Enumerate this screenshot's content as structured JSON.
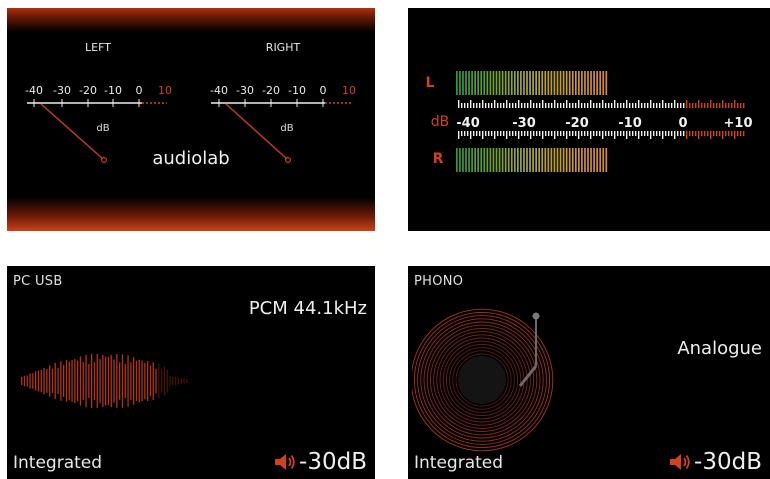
{
  "analog_meter": {
    "left_label": "LEFT",
    "right_label": "RIGHT",
    "scale": [
      "-40",
      "-30",
      "-20",
      "-10",
      "0",
      "10"
    ],
    "unit": "dB",
    "logo": "audiolab"
  },
  "bar_meter": {
    "left_label": "L",
    "right_label": "R",
    "unit": "dB",
    "scale": [
      "-40",
      "-30",
      "-20",
      "-10",
      "0",
      "+10"
    ],
    "accent": "#d2401e"
  },
  "usb_screen": {
    "source": "PC USB",
    "format": "PCM 44.1kHz",
    "mode": "Integrated",
    "volume": "-30dB",
    "icon": "speaker-icon"
  },
  "phono_screen": {
    "source": "PHONO",
    "format": "Analogue",
    "mode": "Integrated",
    "volume": "-30dB",
    "icon": "speaker-icon"
  }
}
